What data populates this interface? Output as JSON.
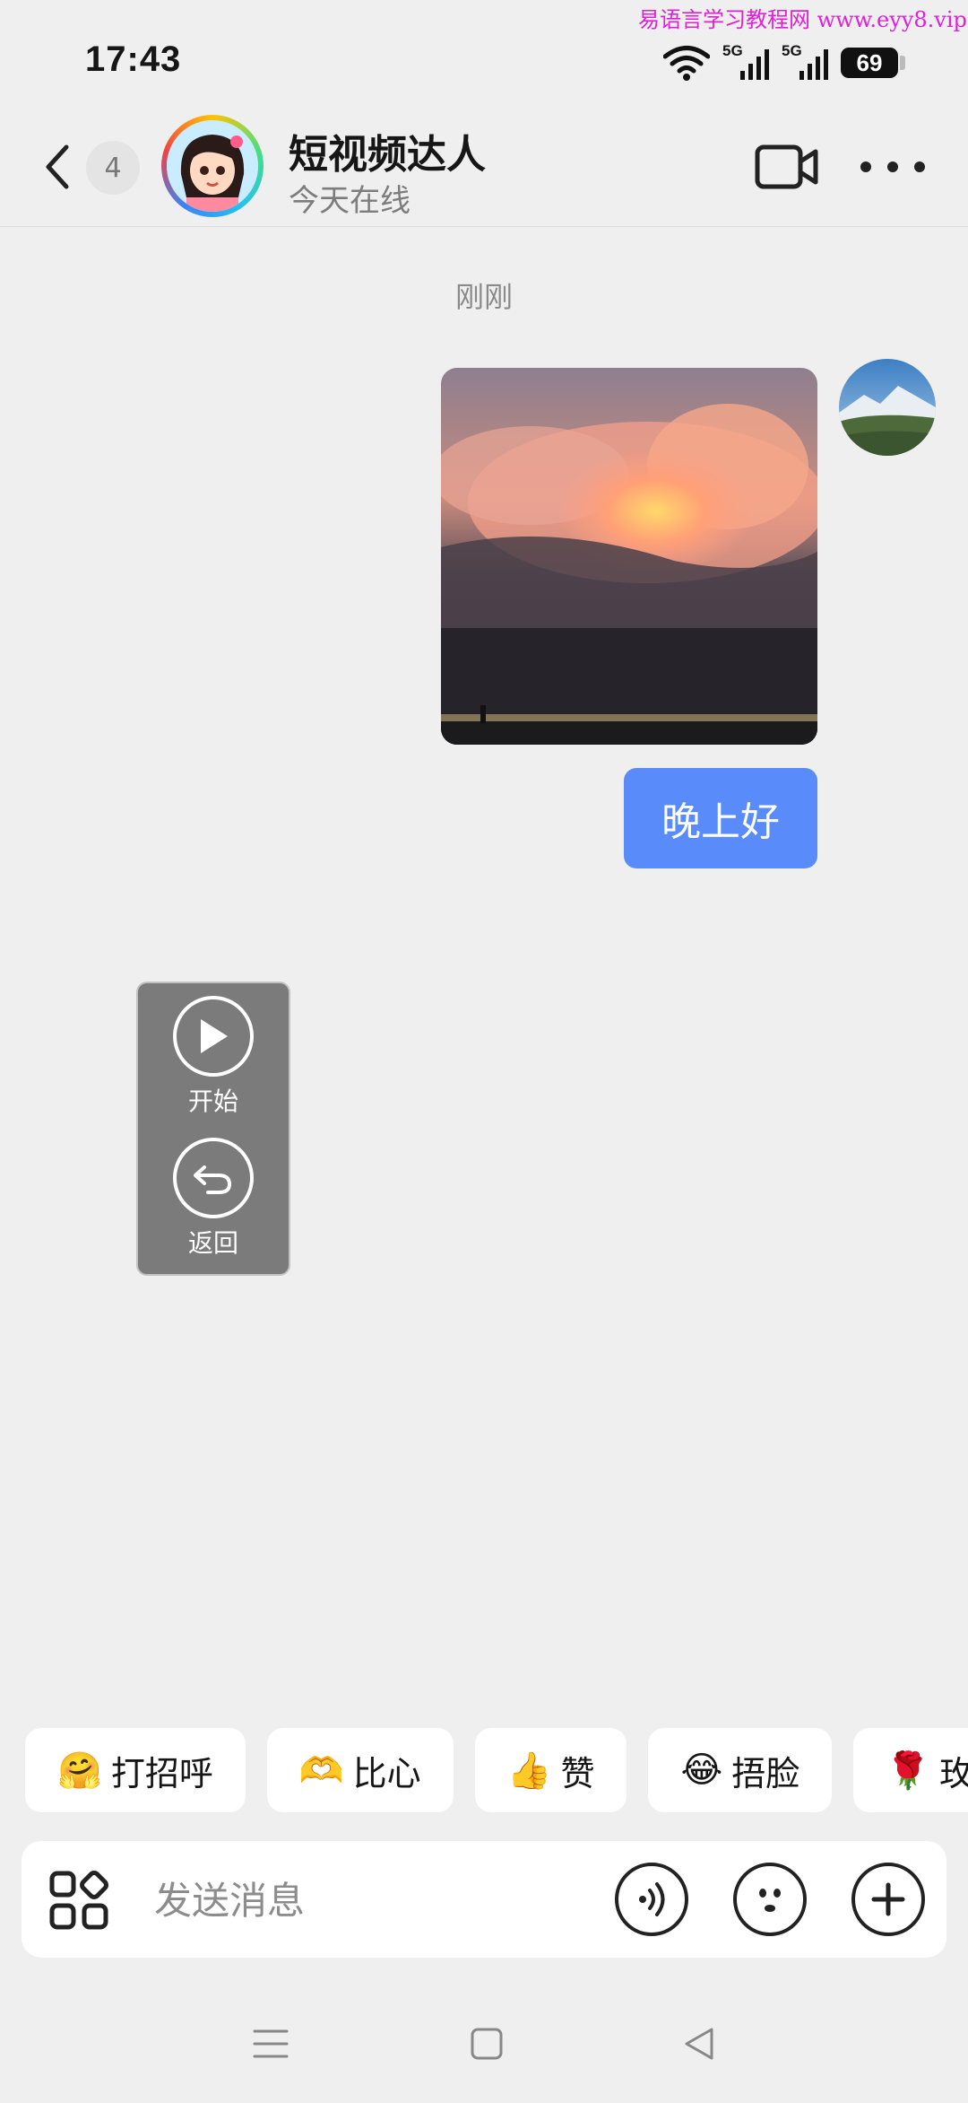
{
  "status_bar": {
    "time": "17:43",
    "network_1": "5G",
    "network_2": "5G",
    "battery": "69",
    "watermark": "易语言学习教程网 www.eyy8.vip"
  },
  "header": {
    "unread_count": "4",
    "contact_name": "短视频达人",
    "contact_status": "今天在线"
  },
  "chat": {
    "timestamp": "刚刚",
    "messages": [
      {
        "type": "image",
        "description_icon": "sunset-clouds-photo"
      },
      {
        "type": "text",
        "text": "晚上好"
      }
    ]
  },
  "floating_panel": {
    "start_label": "开始",
    "back_label": "返回"
  },
  "quick_replies": [
    {
      "emoji": "🤗",
      "label": "打招呼"
    },
    {
      "emoji": "🫶",
      "label": "比心"
    },
    {
      "emoji": "👍",
      "label": "赞"
    },
    {
      "emoji": "😂",
      "label": "捂脸"
    },
    {
      "emoji": "🌹",
      "label": "玫"
    }
  ],
  "input": {
    "placeholder": "发送消息"
  },
  "colors": {
    "bubble": "#5a8bfa",
    "background": "#efefef",
    "watermark": "#e020d8"
  }
}
